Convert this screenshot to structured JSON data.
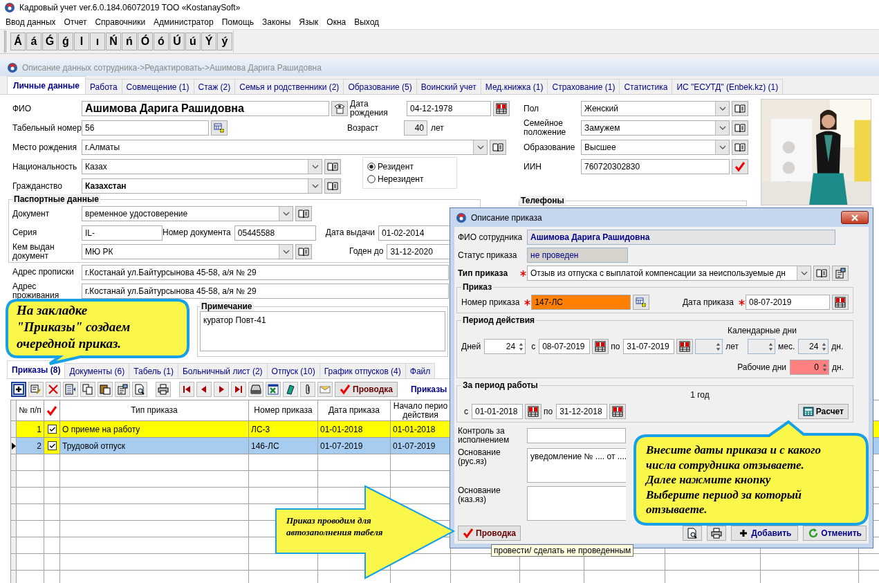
{
  "app_window": {
    "title": "Кадровый учет ver.6.0.184.06072019 ТОО «KostanaySoft»"
  },
  "menu": [
    "Ввод данных",
    "Отчет",
    "Справочники",
    "Администратор",
    "Помощь",
    "Законы",
    "Язык",
    "Окна",
    "Выход"
  ],
  "letter_keys": [
    "Á",
    "á",
    "Ǵ",
    "ǵ",
    "I",
    "ı",
    "Ń",
    "ń",
    "Ó",
    "ó",
    "Ú",
    "ú",
    "Ý",
    "ý"
  ],
  "employee_window": {
    "title": "Описание данных сотрудника->Редактировать->Ашимова Дарига Рашидовна"
  },
  "tabs": [
    {
      "label": "Личные данные",
      "selected": true
    },
    {
      "label": "Работа",
      "selected": false
    },
    {
      "label": "Совмещение (1)",
      "selected": false
    },
    {
      "label": "Стаж (2)",
      "selected": false
    },
    {
      "label": "Семья и родственники (2)",
      "selected": false
    },
    {
      "label": "Образование (5)",
      "selected": false
    },
    {
      "label": "Воинский учет",
      "selected": false
    },
    {
      "label": "Мед.книжка (1)",
      "selected": false
    },
    {
      "label": "Страхование (1)",
      "selected": false
    },
    {
      "label": "Статистика",
      "selected": false
    },
    {
      "label": "ИС \"ЕСУТД\" (Enbek.kz) (1)",
      "selected": false
    }
  ],
  "personal": {
    "full_name": {
      "label": "ФИО",
      "value": "Ашимова Дарига Рашидовна"
    },
    "birth_date": {
      "label": "Дата рождения",
      "value": "04-12-1978"
    },
    "personnel_number": {
      "label": "Табельный номер",
      "value": "56"
    },
    "age": {
      "label": "Возраст",
      "value": "40",
      "unit": "лет"
    },
    "birthplace": {
      "label": "Место рождения",
      "value": "г.Алматы"
    },
    "nationality": {
      "label": "Национальность",
      "value": "Казах"
    },
    "citizenship": {
      "label": "Гражданство",
      "value": "Казахстан"
    },
    "residency": [
      {
        "label": "Резидент",
        "selected": true
      },
      {
        "label": "Нерезидент",
        "selected": false
      }
    ],
    "gender": {
      "label": "Пол",
      "value": "Женский"
    },
    "marital_status": {
      "label": "Семейное положение",
      "value": "Замужем"
    },
    "education": {
      "label": "Образование",
      "value": "Высшее"
    },
    "iin": {
      "label": "ИИН",
      "value": "760720302830"
    },
    "phones": {
      "title": "Телефоны"
    }
  },
  "passport": {
    "title": "Паспортные данные",
    "document": {
      "label": "Документ",
      "value": "временное удостоверение"
    },
    "series": {
      "label": "Серия",
      "value": "IL-"
    },
    "number": {
      "label": "Номер документа",
      "value": "05445588"
    },
    "issue_date": {
      "label": "Дата выдачи",
      "value": "01-02-2014"
    },
    "issued_by": {
      "label": "Кем выдан документ",
      "value": "МЮ РК"
    },
    "valid_until": {
      "label": "Годен до",
      "value": "31-12-2020"
    }
  },
  "registration_address": {
    "label": "Адрес прописки",
    "value": "г.Костанай ул.Байтурсынова 45-58, а/я № 29"
  },
  "residence_address": {
    "label": "Адрес проживания",
    "value": "г.Костанай ул.Байтурсынова 45-58, а/я № 29"
  },
  "note": {
    "title": "Примечание",
    "value": "куратор Повт-41"
  },
  "bottom_tabs": [
    {
      "label": "Приказы (8)",
      "selected": true
    },
    {
      "label": "Документы (6)",
      "selected": false
    },
    {
      "label": "Табель (1)",
      "selected": false
    },
    {
      "label": "Больничный лист (2)",
      "selected": false
    },
    {
      "label": "Отпуск (10)",
      "selected": false
    },
    {
      "label": "График отпусков (4)",
      "selected": false
    },
    {
      "label": "Файл",
      "selected": false
    }
  ],
  "orders_toolbar": {
    "post_button": "Проводка",
    "title": "Приказы"
  },
  "orders_table": {
    "columns": [
      "№ п/п",
      "Тип приказа",
      "Номер приказа",
      "Дата приказа",
      "Начало перио действия"
    ],
    "rows": [
      {
        "number": "1",
        "checked": true,
        "type": "О приеме на работу",
        "order_number": "ЛС-3",
        "order_date": "01-01-2018",
        "start_date": "01-01-2018",
        "highlighted": true,
        "selected": false
      },
      {
        "number": "2",
        "checked": true,
        "type": "Трудовой отпуск",
        "order_number": "146-ЛС",
        "order_date": "01-07-2019",
        "start_date": "01-07-2019",
        "highlighted": true,
        "selected": true
      }
    ]
  },
  "order_dialog": {
    "title": "Описание приказа",
    "employee": {
      "label": "ФИО сотрудника",
      "value": "Ашимова Дарига Рашидовна"
    },
    "status": {
      "label": "Статус приказа",
      "value": "не проведен"
    },
    "order_type": {
      "label": "Тип приказа",
      "value": "Отзыв из отпуска с выплатой компенсации за неиспользуемые дн",
      "required": true
    },
    "order": {
      "title": "Приказ",
      "number": {
        "label": "Номер приказа",
        "value": "147-ЛС",
        "required": true
      },
      "date": {
        "label": "Дата приказа",
        "value": "08-07-2019",
        "required": true
      }
    },
    "period": {
      "title": "Период действия",
      "days": {
        "label": "Дней",
        "value": "24"
      },
      "from": {
        "label": "с",
        "value": "08-07-2019"
      },
      "to": {
        "label": "по",
        "value": "31-07-2019"
      },
      "calendar_days_label": "Календарные дни",
      "years": {
        "unit": "лет",
        "disabled": true
      },
      "months": {
        "unit": "мес.",
        "disabled": true
      },
      "calendar_days": {
        "value": "24",
        "unit": "дн."
      },
      "working_days": {
        "label": "Рабочие дни",
        "value": "0",
        "unit": "дн."
      }
    },
    "work_period": {
      "title": "За период работы",
      "duration": "1 год",
      "from": {
        "label": "с",
        "value": "01-01-2018"
      },
      "to": {
        "label": "по",
        "value": "31-12-2018"
      },
      "calc_button": "Расчет"
    },
    "control": {
      "label": "Контроль за исполнением"
    },
    "basis_ru": {
      "label": "Основание (рус.яз)",
      "value": "уведомление № .... от ...."
    },
    "basis_kz": {
      "label": "Основание (каз.яз)"
    },
    "buttons": {
      "post": "Проводка",
      "add": "Добавить",
      "cancel": "Отменить"
    }
  },
  "tooltip": "провести/ сделать не проведенным",
  "callouts": [
    {
      "text": "На закладке\n\"Приказы\" создаем\nочередной приказ."
    },
    {
      "text": "Внесите даты приказа и с какого\nчисла сотрудника отзываете.\nДалее нажмите кнопку\nВыберите период за который\nотзываете."
    }
  ],
  "arrow_note": {
    "text": "Приказ проводим для\nавтозаполнения табеля"
  }
}
